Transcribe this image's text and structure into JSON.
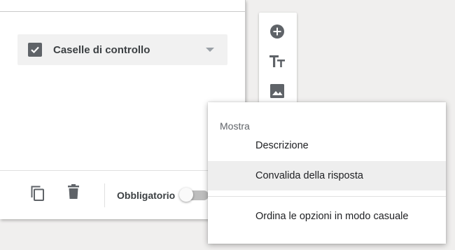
{
  "question_card": {
    "type_dropdown": {
      "label": "Caselle di controllo",
      "icon": "checkbox-checked-icon"
    },
    "footer": {
      "duplicate_icon": "copy-icon",
      "delete_icon": "trash-icon",
      "required_label": "Obbligatorio",
      "required_on": false
    }
  },
  "side_toolbar": {
    "items": [
      {
        "icon": "add-circle-icon"
      },
      {
        "icon": "text-title-icon"
      },
      {
        "icon": "image-icon"
      }
    ]
  },
  "context_menu": {
    "header": "Mostra",
    "items": [
      {
        "label": "Descrizione"
      },
      {
        "label": "Convalida della risposta"
      },
      {
        "label": "Ordina le opzioni in modo casuale"
      }
    ]
  },
  "colors": {
    "background": "#f0efee",
    "card": "#ffffff",
    "icon": "#5f6368",
    "highlight": "#eeeeee"
  }
}
